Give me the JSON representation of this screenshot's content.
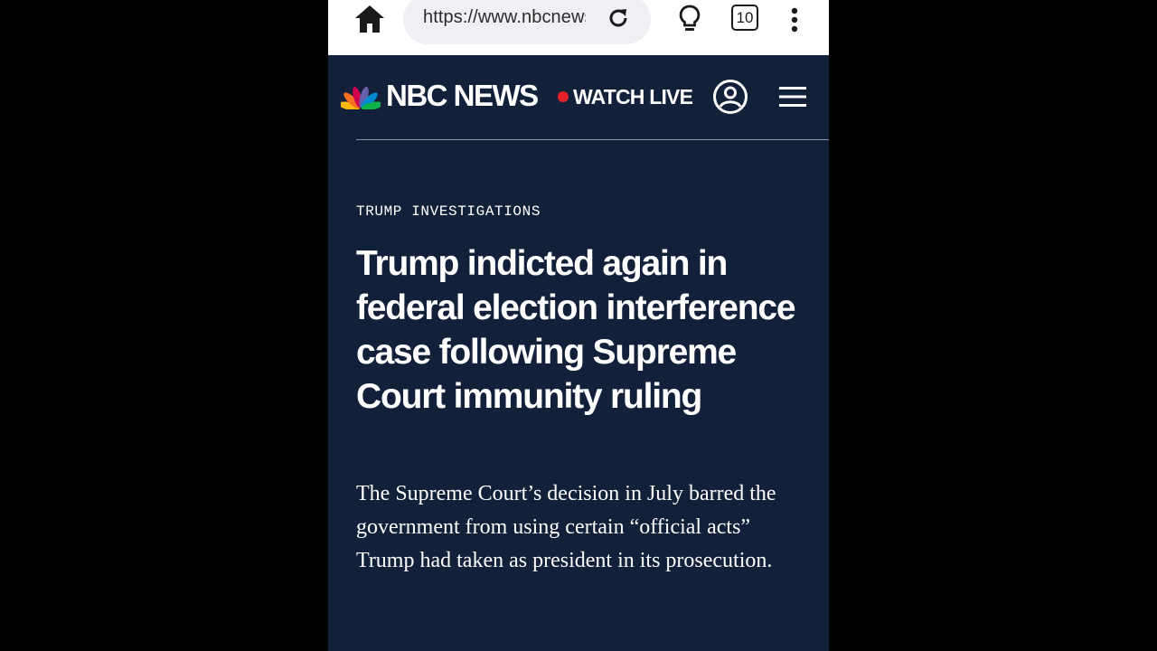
{
  "browser": {
    "url": "https://www.nbcnews.com",
    "tab_count": "10"
  },
  "site": {
    "brand": "NBC NEWS",
    "watch_live": "WATCH LIVE",
    "peacock_colors": [
      "#fcb711",
      "#f37021",
      "#cc004c",
      "#6460aa",
      "#0089d0",
      "#0db14b"
    ]
  },
  "icons": {
    "home": "home-icon",
    "reload": "reload-icon",
    "bulb": "lightbulb-icon",
    "more": "more-vertical-icon",
    "account": "account-icon",
    "menu": "hamburger-menu-icon"
  },
  "article": {
    "section": "TRUMP INVESTIGATIONS",
    "headline": "Trump indicted again in federal election interference case following Supreme Court immunity ruling",
    "dek": "The Supreme Court’s decision in July barred the government from using certain “official acts” Trump had taken as president in its prosecution."
  },
  "colors": {
    "page_background": "#132039",
    "live_dot": "#e8202a",
    "url_bar": "#eef0f4"
  }
}
